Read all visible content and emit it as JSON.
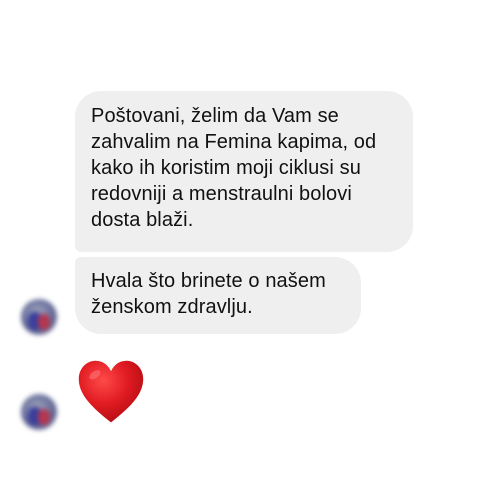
{
  "conversation": {
    "messages": [
      {
        "type": "text",
        "lines": [
          "Poštovani, želim da Vam se",
          "zahvalim na Femina kapima, od",
          "kako ih koristim moji ciklusi su",
          "redovniji a menstraulni bolovi",
          "dosta blaži."
        ]
      },
      {
        "type": "text",
        "lines": [
          "Hvala što brinete o našem",
          "ženskom zdravlju."
        ]
      },
      {
        "type": "reaction",
        "icon": "red-heart-icon",
        "color": "#d8121b"
      }
    ]
  },
  "theme": {
    "bubble_color": "#efefef",
    "text_color": "#111111",
    "background": "#ffffff"
  }
}
